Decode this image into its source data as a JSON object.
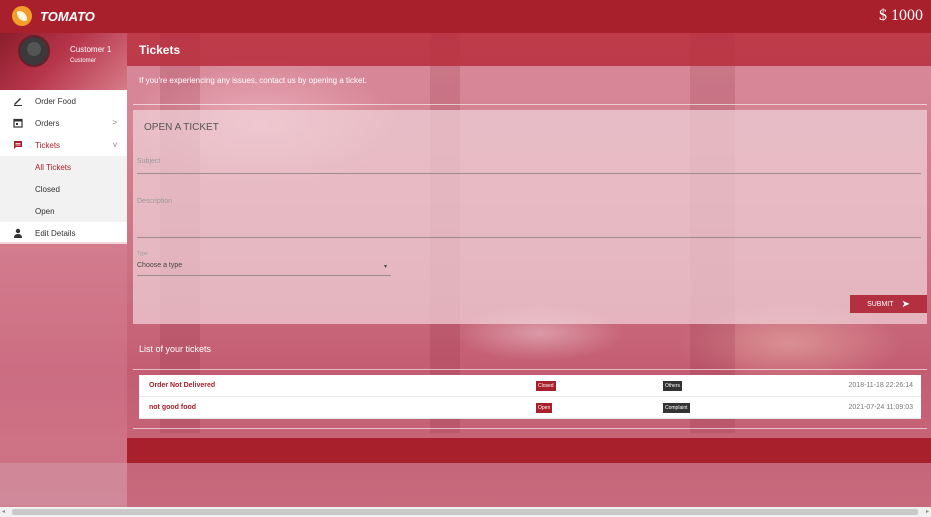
{
  "topbar": {
    "brand": "TOMATO",
    "balance": "$ 1000"
  },
  "profile": {
    "name": "Customer 1",
    "role": "Customer"
  },
  "menu": {
    "order_food": "Order Food",
    "orders": "Orders",
    "orders_chev": ">",
    "tickets": "Tickets",
    "tickets_chev": "v",
    "all_tickets": "All Tickets",
    "closed": "Closed",
    "open": "Open",
    "edit_details": "Edit Details"
  },
  "main": {
    "title": "Tickets",
    "intro": "If you're experiencing any issues, contact us by opening a ticket."
  },
  "form": {
    "title": "OPEN A TICKET",
    "subject_placeholder": "Subject",
    "description_placeholder": "Description",
    "type_label": "Type",
    "type_value": "Choose a type",
    "type_arrow": "▾",
    "submit_label": "SUBMIT",
    "submit_icon": "➤"
  },
  "list": {
    "title": "List of your tickets",
    "tickets": [
      {
        "subject": "Order Not Delivered",
        "status": "Closed",
        "category": "Others",
        "date": "2018-11-18 22:26:14"
      },
      {
        "subject": "not good food",
        "status": "Open",
        "category": "Complaint",
        "date": "2021-07-24 11:09:03"
      }
    ]
  },
  "colors": {
    "primary": "#a8202b",
    "accent": "#f39c2a"
  },
  "icons": [
    "pencil-icon",
    "calendar-icon",
    "chat-icon",
    "person-icon",
    "send-icon"
  ]
}
